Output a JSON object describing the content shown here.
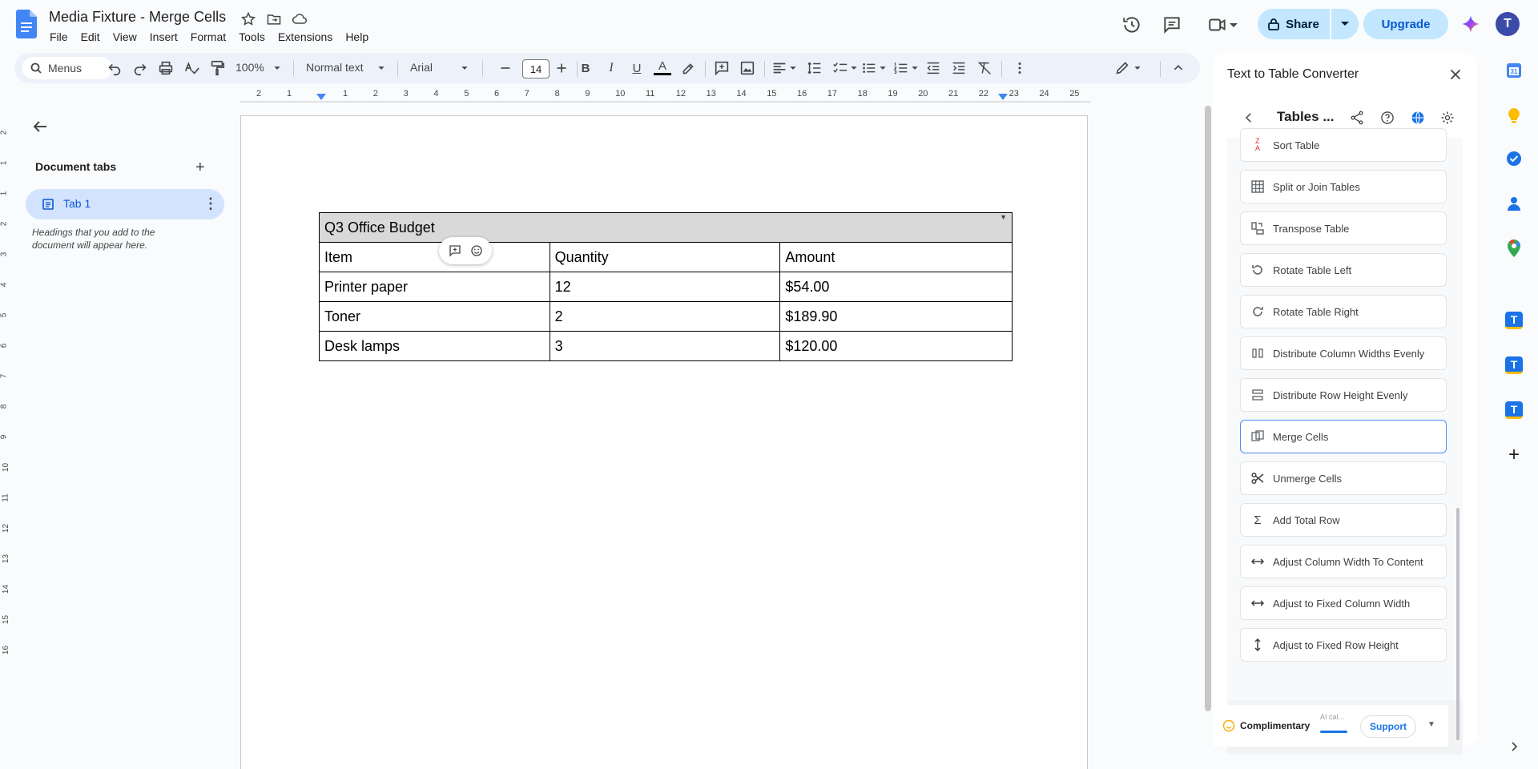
{
  "app": {
    "doc_title": "Media Fixture - Merge Cells",
    "menu": [
      "File",
      "Edit",
      "View",
      "Insert",
      "Format",
      "Tools",
      "Extensions",
      "Help"
    ],
    "share_label": "Share",
    "upgrade_label": "Upgrade",
    "avatar_initial": "T"
  },
  "toolbar": {
    "menus_label": "Menus",
    "zoom": "100%",
    "style": "Normal text",
    "font": "Arial",
    "font_size": "14"
  },
  "ruler": {
    "numbers": [
      "2",
      "1",
      "1",
      "2",
      "3",
      "4",
      "5",
      "6",
      "7",
      "8",
      "9",
      "10",
      "11",
      "12",
      "13",
      "14",
      "15",
      "16",
      "17",
      "18",
      "19",
      "20",
      "21",
      "22",
      "23",
      "24",
      "25"
    ]
  },
  "vruler": {
    "numbers": [
      "2",
      "1",
      "1",
      "2",
      "3",
      "4",
      "5",
      "6",
      "7",
      "8",
      "9",
      "10",
      "11",
      "12",
      "13",
      "14",
      "15",
      "16"
    ]
  },
  "outline": {
    "title": "Document tabs",
    "tab_label": "Tab 1",
    "hint": "Headings that you add to the document will appear here."
  },
  "document": {
    "table_title": "Q3 Office Budget",
    "headers": [
      "Item",
      "Quantity",
      "Amount"
    ],
    "rows": [
      [
        "Printer paper",
        "12",
        "$54.00"
      ],
      [
        "Toner",
        "2",
        "$189.90"
      ],
      [
        "Desk lamps",
        "3",
        "$120.00"
      ]
    ]
  },
  "sidepanel": {
    "title": "Text to Table Converter",
    "header_title": "Tables ...",
    "items": [
      {
        "label": "Sort Table",
        "icon": "sort-az-icon"
      },
      {
        "label": "Split or Join Tables",
        "icon": "grid-icon"
      },
      {
        "label": "Transpose Table",
        "icon": "transpose-icon"
      },
      {
        "label": "Rotate Table Left",
        "icon": "rotate-left-icon"
      },
      {
        "label": "Rotate Table Right",
        "icon": "rotate-right-icon"
      },
      {
        "label": "Distribute Column Widths Evenly",
        "icon": "distribute-columns-icon"
      },
      {
        "label": "Distribute Row Height Evenly",
        "icon": "distribute-rows-icon"
      },
      {
        "label": "Merge Cells",
        "icon": "merge-icon"
      },
      {
        "label": "Unmerge Cells",
        "icon": "scissors-icon"
      },
      {
        "label": "Add Total Row",
        "icon": "sigma-icon"
      },
      {
        "label": "Adjust Column Width To Content",
        "icon": "width-arrows-icon"
      },
      {
        "label": "Adjust to Fixed Column Width",
        "icon": "width-arrows-icon"
      },
      {
        "label": "Adjust to Fixed Row Height",
        "icon": "height-arrows-icon"
      }
    ],
    "plan_label": "Complimentary",
    "ai_label": "AI cal...",
    "support_label": "Support"
  },
  "colors": {
    "accent": "#0b57d0",
    "share_bg": "#c2e7ff",
    "tab_active_bg": "#d3e3fd",
    "table_header_bg": "#d9d9d9"
  }
}
